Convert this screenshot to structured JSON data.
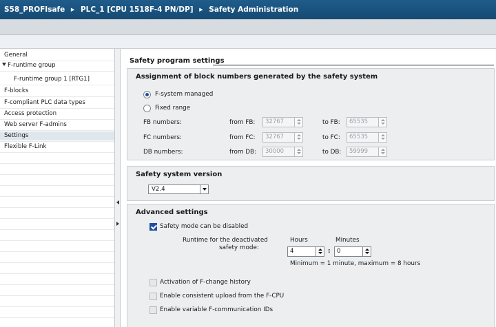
{
  "breadcrumb": [
    "S58_PROFIsafe",
    "PLC_1 [CPU 1518F-4 PN/DP]",
    "Safety Administration"
  ],
  "breadcrumb_separator": "▶",
  "nav": {
    "items": [
      {
        "label": "General",
        "indent": 0,
        "active": false
      },
      {
        "label": "F-runtime group",
        "indent": 0,
        "active": false,
        "expanded": true
      },
      {
        "label": "F-runtime group 1 [RTG1]",
        "indent": 2,
        "active": false
      },
      {
        "label": "F-blocks",
        "indent": 0,
        "active": false
      },
      {
        "label": "F-compliant PLC data types",
        "indent": 0,
        "active": false
      },
      {
        "label": "Access protection",
        "indent": 0,
        "active": false
      },
      {
        "label": "Web server F-admins",
        "indent": 0,
        "active": false
      },
      {
        "label": "Settings",
        "indent": 0,
        "active": true
      },
      {
        "label": "Flexible F-Link",
        "indent": 0,
        "active": false
      }
    ]
  },
  "page": {
    "heading": "Safety program settings"
  },
  "assignment": {
    "title": "Assignment of block numbers generated by the safety system",
    "radio_managed": "F-system managed",
    "radio_fixed": "Fixed range",
    "selected": "F-system managed",
    "rows": [
      {
        "label": "FB numbers:",
        "from_label": "from FB:",
        "from": "32767",
        "to_label": "to FB:",
        "to": "65535"
      },
      {
        "label": "FC numbers:",
        "from_label": "from FC:",
        "from": "32767",
        "to_label": "to FC:",
        "to": "65535"
      },
      {
        "label": "DB numbers:",
        "from_label": "from DB:",
        "from": "30000",
        "to_label": "to DB:",
        "to": "59999"
      }
    ]
  },
  "version": {
    "title": "Safety system version",
    "selected": "V2.4"
  },
  "advanced": {
    "title": "Advanced settings",
    "safety_mode_label": "Safety mode can be disabled",
    "safety_mode_checked": true,
    "runtime_label_1": "Runtime for the deactivated",
    "runtime_label_2": "safety mode:",
    "hours_label": "Hours",
    "minutes_label": "Minutes",
    "hours": "4",
    "minutes": "0",
    "colon": ":",
    "hint": "Minimum = 1 minute, maximum = 8 hours",
    "options": [
      {
        "label": "Activation of F-change history",
        "checked": false
      },
      {
        "label": "Enable consistent upload from the F-CPU",
        "checked": false
      },
      {
        "label": "Enable variable F-communication IDs",
        "checked": false
      }
    ]
  },
  "colors": {
    "title_bar": "#1f5c8a",
    "section_bg": "#eceef0",
    "accent": "#1f4e9e"
  }
}
